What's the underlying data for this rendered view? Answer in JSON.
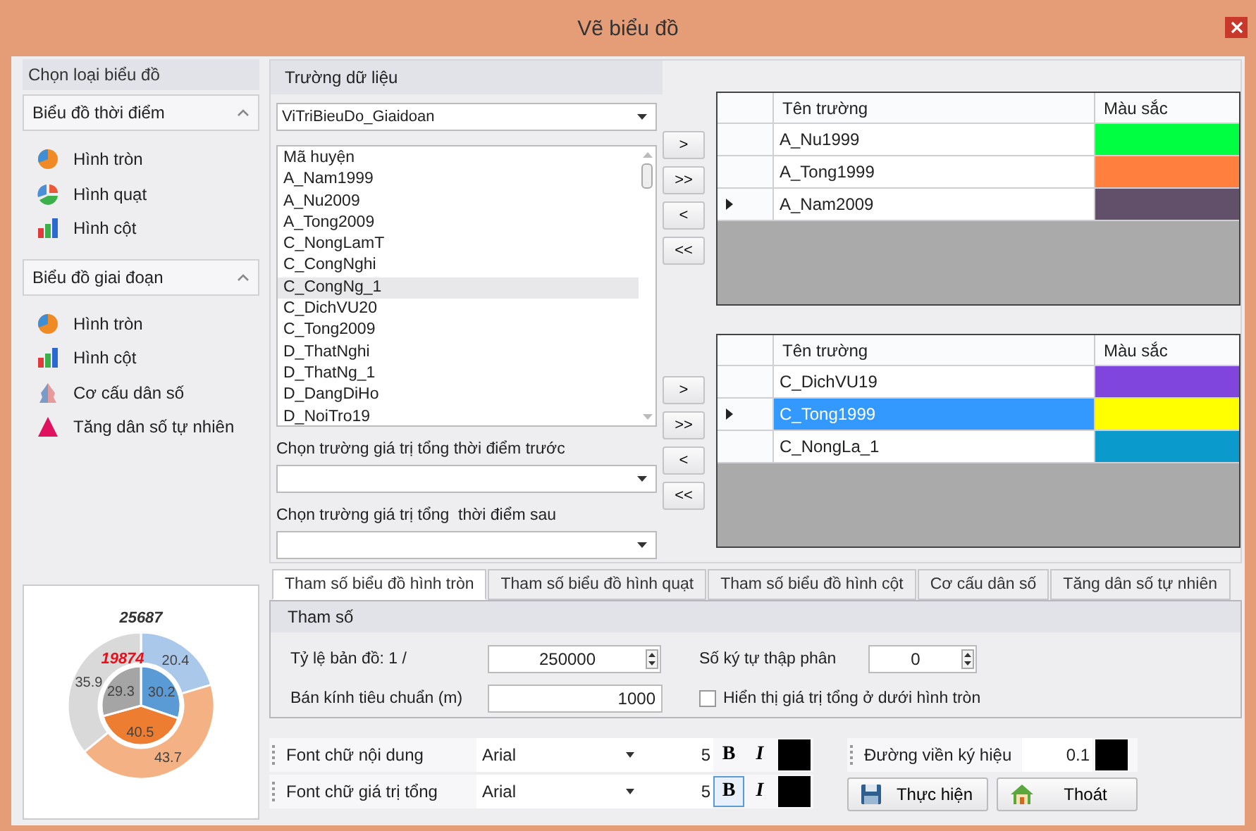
{
  "window": {
    "title": "Vẽ biểu đồ"
  },
  "sidebar": {
    "title": "Chọn loại biểu đồ",
    "groups": [
      {
        "title": "Biểu đồ thời điểm",
        "expanded": true,
        "items": [
          {
            "label": "Hình tròn",
            "kind": "pie"
          },
          {
            "label": "Hình quạt",
            "kind": "sector"
          },
          {
            "label": "Hình cột",
            "kind": "bar"
          }
        ]
      },
      {
        "title": "Biểu đồ giai đoạn",
        "expanded": true,
        "items": [
          {
            "label": "Hình tròn",
            "kind": "pie"
          },
          {
            "label": "Hình cột",
            "kind": "bar"
          },
          {
            "label": "Cơ cấu dân số",
            "kind": "pyramid"
          },
          {
            "label": "Tăng dân số tự nhiên",
            "kind": "triangle"
          }
        ]
      }
    ]
  },
  "preview": {
    "chart_data": {
      "type": "donut",
      "title": "25687",
      "annotations": [
        "19874"
      ],
      "data_labels": true,
      "series": [
        {
          "colors": [
            "#a9c8ea",
            "#f4b183",
            "#d9d9d9"
          ],
          "values": [
            20.4,
            43.7,
            35.9
          ]
        },
        {
          "colors": [
            "#5b9bd5",
            "#ed7d31",
            "#a5a5a5"
          ],
          "values": [
            30.2,
            40.5,
            29.3
          ]
        }
      ]
    }
  },
  "data_fields": {
    "title": "Trường dữ liệu",
    "source": "ViTriBieuDo_Giaidoan",
    "fields": [
      {
        "label": "Mã huyện",
        "selected": false
      },
      {
        "label": "A_Nam1999",
        "selected": false
      },
      {
        "label": "A_Nu2009",
        "selected": false
      },
      {
        "label": "A_Tong2009",
        "selected": false
      },
      {
        "label": "C_NongLamT",
        "selected": false
      },
      {
        "label": "C_CongNghi",
        "selected": false
      },
      {
        "label": "C_CongNg_1",
        "selected": true
      },
      {
        "label": "C_DichVU20",
        "selected": false
      },
      {
        "label": "C_Tong2009",
        "selected": false
      },
      {
        "label": "D_ThatNghi",
        "selected": false
      },
      {
        "label": "D_ThatNg_1",
        "selected": false
      },
      {
        "label": "D_DangDiHo",
        "selected": false
      },
      {
        "label": "D_NoiTro19",
        "selected": false
      }
    ],
    "before_label": "Chọn trường giá trị tổng thời điểm trước",
    "after_label": "Chọn trường giá trị tổng  thời điểm sau"
  },
  "grids": [
    {
      "move_buttons": [
        ">",
        ">>",
        "<",
        "<<"
      ],
      "columns": [
        "Tên trường",
        "Màu sắc"
      ],
      "rows": [
        {
          "name": "A_Nu1999",
          "color": "#00ff40",
          "current": false,
          "selected": false
        },
        {
          "name": "A_Tong1999",
          "color": "#ff7f3f",
          "current": false,
          "selected": false
        },
        {
          "name": "A_Nam2009",
          "color": "#62506a",
          "current": true,
          "selected": false
        }
      ]
    },
    {
      "move_buttons": [
        ">",
        ">>",
        "<",
        "<<"
      ],
      "columns": [
        "Tên trường",
        "Màu sắc"
      ],
      "rows": [
        {
          "name": "C_DichVU19",
          "color": "#7f45dd",
          "current": false,
          "selected": false
        },
        {
          "name": "C_Tong1999",
          "color": "#ffff00",
          "current": true,
          "selected": true
        },
        {
          "name": "C_NongLa_1",
          "color": "#0a9acc",
          "current": false,
          "selected": false
        }
      ]
    }
  ],
  "tabs": [
    {
      "label": "Tham số biểu đồ hình tròn",
      "selected": true
    },
    {
      "label": "Tham số biểu đồ hình quạt",
      "selected": false
    },
    {
      "label": "Tham số biểu đồ hình cột",
      "selected": false
    },
    {
      "label": "Cơ cấu dân số",
      "selected": false
    },
    {
      "label": "Tăng dân số tự nhiên",
      "selected": false
    }
  ],
  "params": {
    "title": "Tham số",
    "scale_label": "Tỷ lệ bản đồ: 1 /",
    "scale": "250000",
    "decimals_label": "Số ký tự thập phân",
    "decimals": "0",
    "radius_label": "Bán kính tiêu chuẩn (m)",
    "radius": "1000",
    "show_total": {
      "label": "Hiển thị giá trị tổng ở dưới hình tròn",
      "checked": false
    }
  },
  "fonts": [
    {
      "label": "Font chữ nội dung",
      "font": "Arial",
      "size": "5",
      "bold_label": "B",
      "italic_label": "I",
      "bold": false,
      "color": "#000000"
    },
    {
      "label": "Font chữ giá trị  tổng",
      "font": "Arial",
      "size": "5",
      "bold_label": "B",
      "italic_label": "I",
      "bold": true,
      "color": "#000000"
    }
  ],
  "border": {
    "label": "Đường viền ký hiệu",
    "value": "0.1",
    "color": "#000000"
  },
  "buttons": [
    {
      "label": "Thực hiện",
      "kind": "save"
    },
    {
      "label": "Thoát",
      "kind": "home"
    }
  ]
}
